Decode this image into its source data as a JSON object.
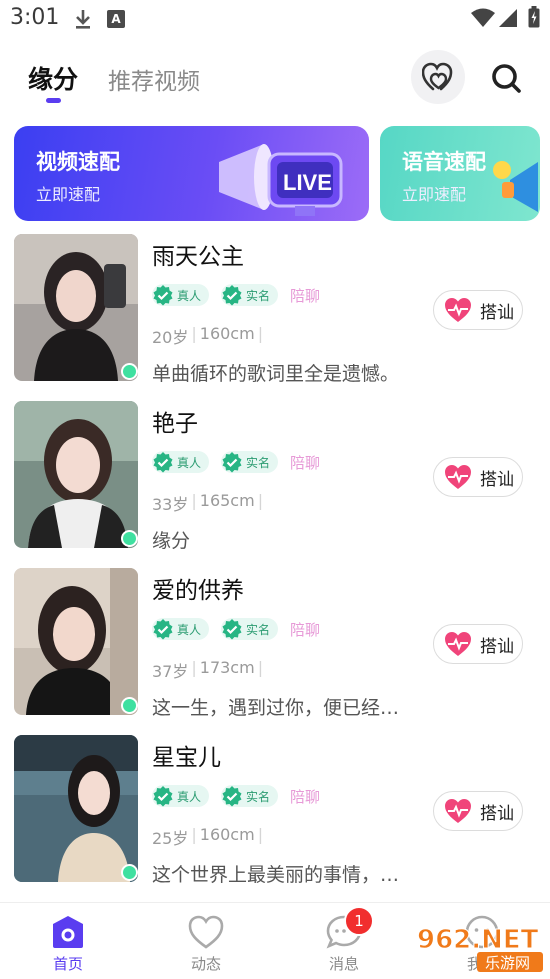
{
  "status_bar": {
    "time": "3:01",
    "a_label": "A"
  },
  "header": {
    "tabs": [
      {
        "label": "缘分",
        "active": true
      },
      {
        "label": "推荐视频",
        "active": false
      }
    ],
    "heart_icon": "double-heart-icon",
    "search_icon": "search-icon"
  },
  "banners": [
    {
      "title": "视频速配",
      "subtitle": "立即速配",
      "art": "live-megaphone-art",
      "colors": [
        "#3b3ff2",
        "#9c6cf7"
      ]
    },
    {
      "title": "语音速配",
      "subtitle": "立即速配",
      "art": "speaker-art",
      "colors": [
        "#56d7c5",
        "#7fe6cf"
      ]
    }
  ],
  "tag_labels": {
    "real_person": "真人",
    "real_name": "实名",
    "chat": "陪聊"
  },
  "greet_label": "搭讪",
  "users": [
    {
      "name": "雨天公主",
      "age": "20岁",
      "height": "160cm",
      "signature": "单曲循环的歌词里全是遗憾。",
      "online": true
    },
    {
      "name": "艳子",
      "age": "33岁",
      "height": "165cm",
      "signature": "缘分",
      "online": true
    },
    {
      "name": "爱的供养",
      "age": "37岁",
      "height": "173cm",
      "signature": "这一生，遇到过你，便已经…",
      "online": true
    },
    {
      "name": "星宝儿",
      "age": "25岁",
      "height": "160cm",
      "signature": "这个世界上最美丽的事情，…",
      "online": true
    }
  ],
  "bottom_nav": [
    {
      "label": "首页",
      "icon": "home-icon",
      "active": true
    },
    {
      "label": "动态",
      "icon": "heart-outline-icon",
      "active": false
    },
    {
      "label": "消息",
      "icon": "message-icon",
      "active": false,
      "badge": "1"
    },
    {
      "label": "我的",
      "icon": "profile-icon",
      "active": false
    }
  ],
  "watermark": {
    "text": "962.NET",
    "subtext": "乐游网"
  },
  "colors": {
    "accent": "#5a3df0",
    "online": "#3fe0a0",
    "badge": "#f12e2e",
    "tag_green": "#2c9c72",
    "chat_pink": "#e79ad7",
    "greet_heart": "#f0447a"
  }
}
